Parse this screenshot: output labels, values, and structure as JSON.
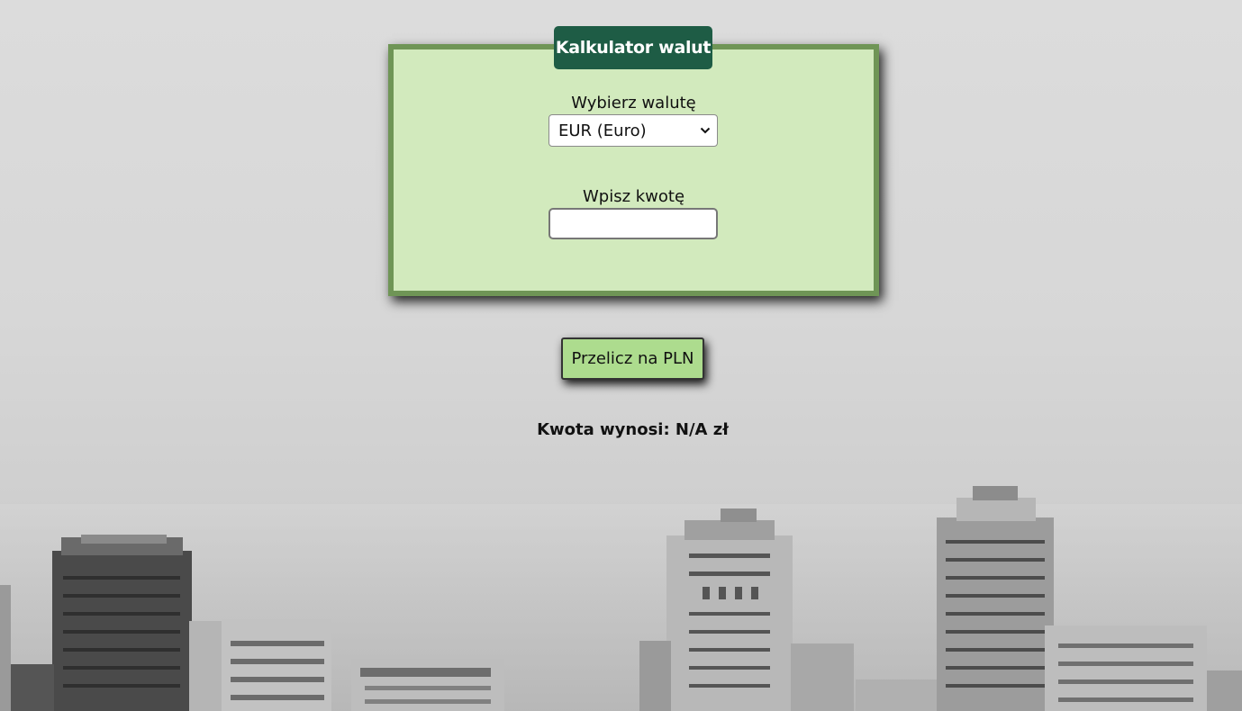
{
  "calculator": {
    "title": "Kalkulator walut",
    "currency_label": "Wybierz walutę",
    "currency_selected": "EUR (Euro)",
    "amount_label": "Wpisz kwotę",
    "amount_value": "",
    "convert_button": "Przelicz na PLN",
    "result_text": "Kwota wynosi: N/A zł"
  },
  "colors": {
    "panel_background": "#d2eabd",
    "panel_border": "#6f9556",
    "title_background": "#1e5c45",
    "button_background": "#addc8e"
  },
  "icons": {
    "select_arrow": "chevron-down-icon"
  }
}
